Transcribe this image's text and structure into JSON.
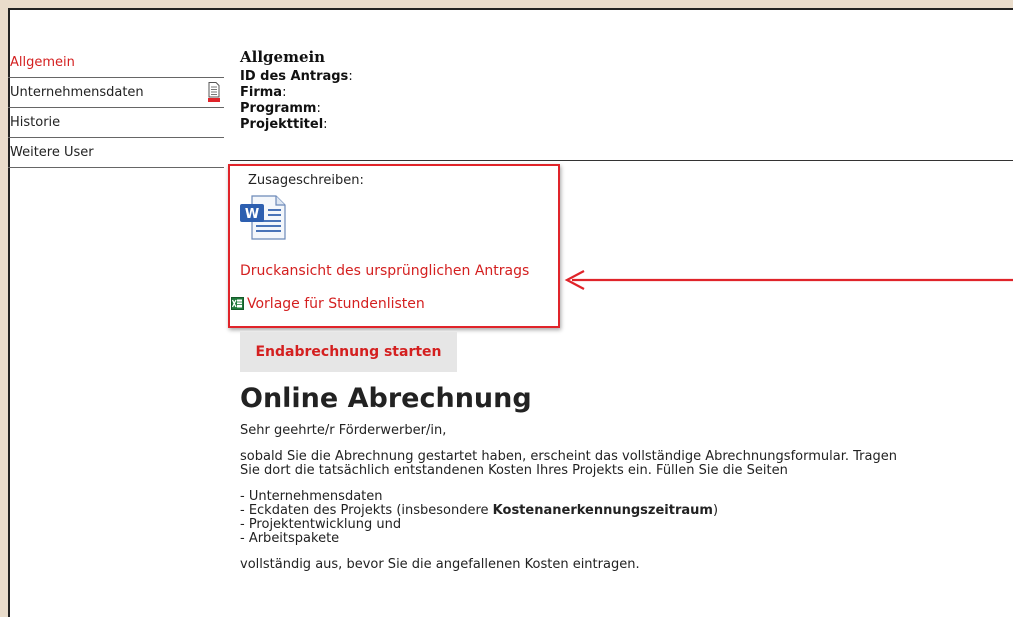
{
  "sidebar": {
    "items": [
      {
        "label": "Allgemein"
      },
      {
        "label": "Unternehmensdaten"
      },
      {
        "label": "Historie"
      },
      {
        "label": "Weitere User"
      }
    ]
  },
  "main": {
    "section_title": "Allgemein",
    "meta": [
      {
        "label": "ID des Antrags",
        "suffix": ":"
      },
      {
        "label": "Firma",
        "suffix": ":"
      },
      {
        "label": "Programm",
        "suffix": ":"
      },
      {
        "label": "Projekttitel",
        "suffix": ":"
      }
    ],
    "zusage_label": "Zusageschreiben:",
    "druck_link": "Druckansicht des ursprünglichen Antrags",
    "vorlage_link": "Vorlage für Stundenlisten",
    "end_button": "Endabrechnung starten",
    "online_title": "Online Abrechnung",
    "greeting": "Sehr geehrte/r Förderwerber/in,",
    "para1_line1": "sobald Sie die Abrechnung gestartet haben, erscheint das vollständige Abrechnungsformular. Tragen",
    "para1_line2": "Sie dort die tatsächlich entstandenen Kosten Ihres Projekts ein. Füllen Sie die Seiten",
    "list": {
      "l1": "- Unternehmensdaten",
      "l2_pre": "- Eckdaten des Projekts (insbesondere ",
      "l2_bold": "Kostenanerkennungszeitraum",
      "l2_post": ")",
      "l3": "- Projektentwicklung und",
      "l4": "- Arbeitspakete"
    },
    "closing": "vollständig aus, bevor Sie die angefallenen Kosten eintragen."
  },
  "colors": {
    "accent_red": "#d42020",
    "annotation_red": "#e0242a"
  }
}
